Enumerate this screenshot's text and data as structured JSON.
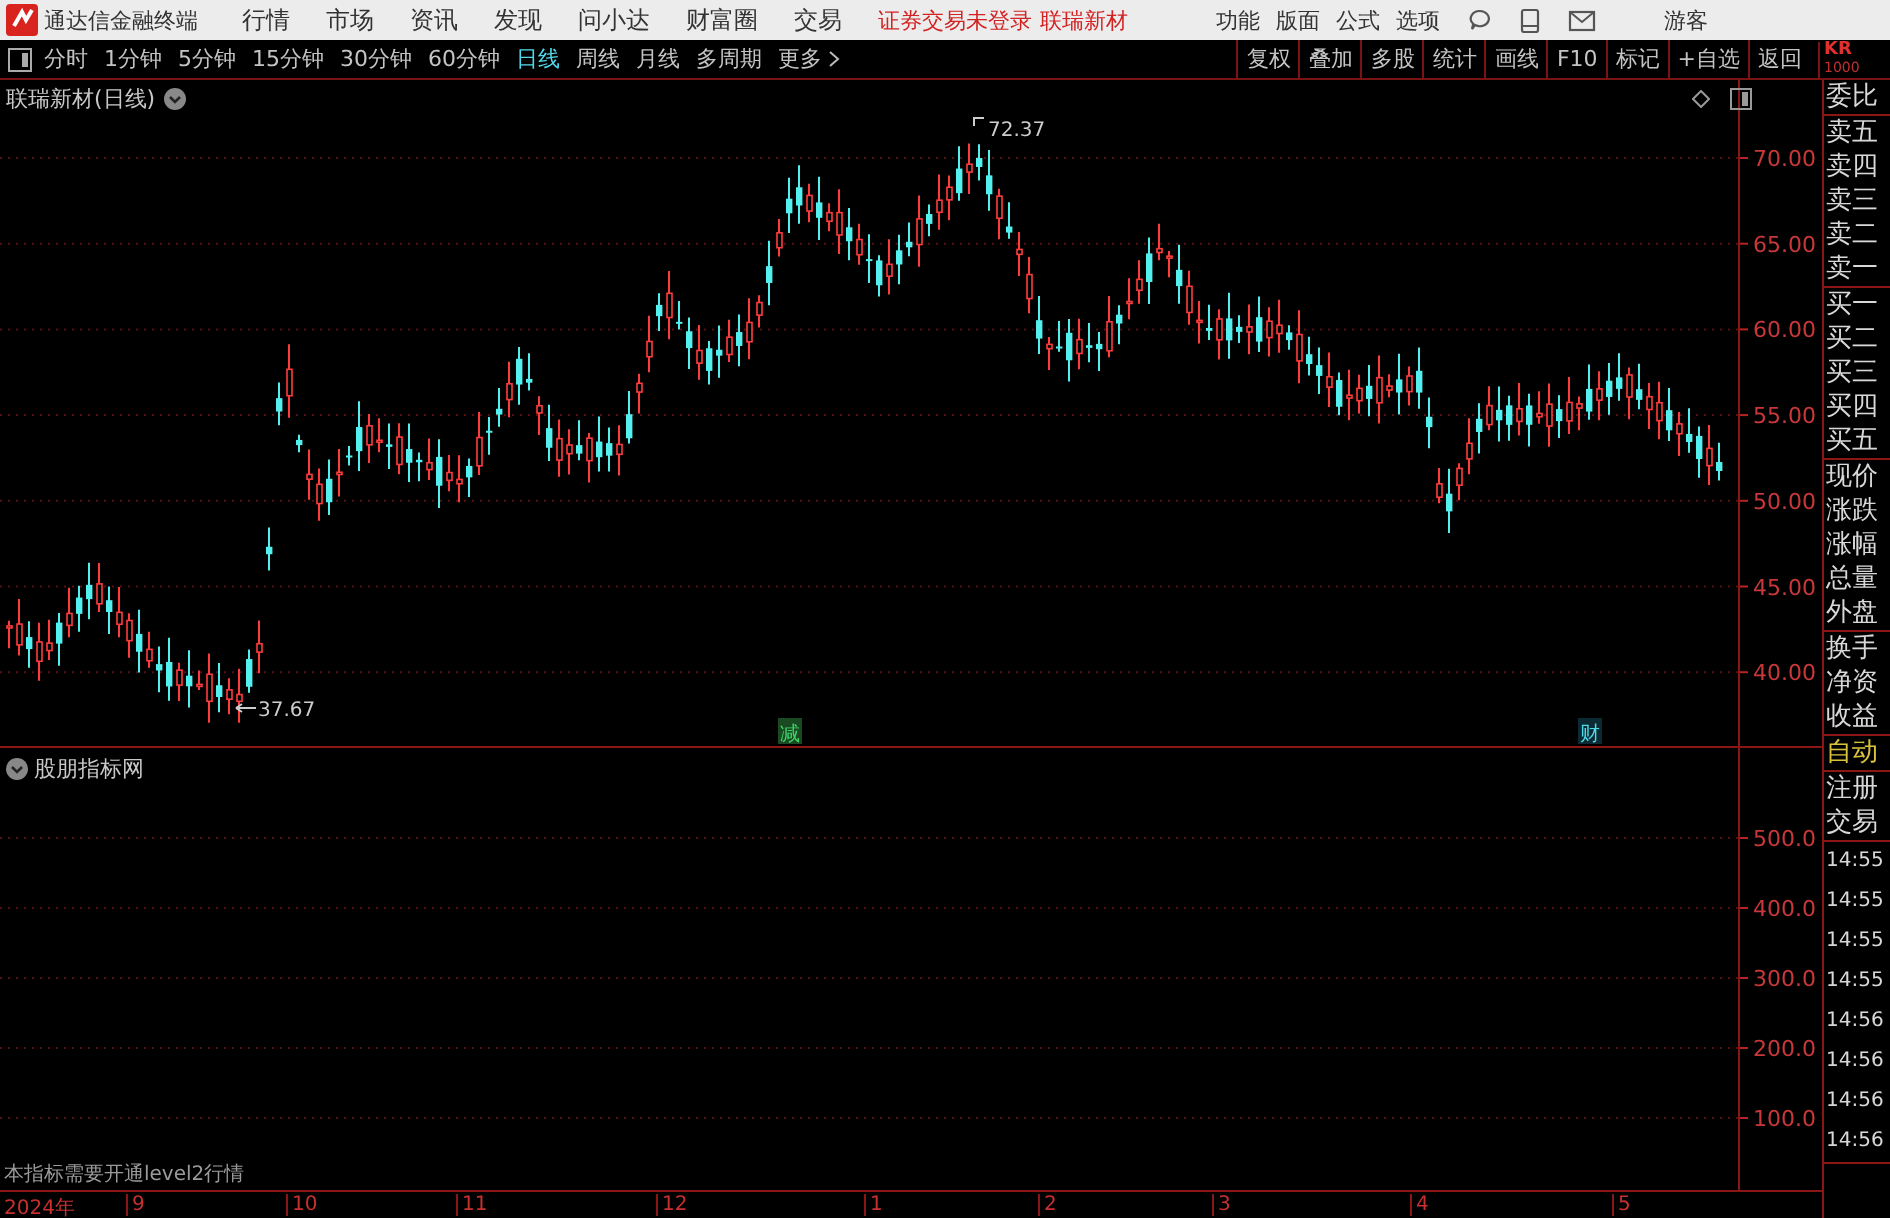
{
  "menu_bar": {
    "app_title": "通达信金融终端",
    "menus": [
      "行情",
      "市场",
      "资讯",
      "发现",
      "问小达",
      "财富圈",
      "交易"
    ],
    "status_notice": "证券交易未登录",
    "stock_link": "联瑞新材",
    "tools": [
      "功能",
      "版面",
      "公式",
      "选项"
    ],
    "user": "游客"
  },
  "period_tabs": [
    {
      "label": "分时",
      "selected": false
    },
    {
      "label": "1分钟",
      "selected": false
    },
    {
      "label": "5分钟",
      "selected": false
    },
    {
      "label": "15分钟",
      "selected": false
    },
    {
      "label": "30分钟",
      "selected": false
    },
    {
      "label": "60分钟",
      "selected": false
    },
    {
      "label": "日线",
      "selected": true
    },
    {
      "label": "周线",
      "selected": false
    },
    {
      "label": "月线",
      "selected": false
    },
    {
      "label": "多周期",
      "selected": false
    },
    {
      "label": "更多",
      "selected": false
    }
  ],
  "toolbar_buttons": [
    "复权",
    "叠加",
    "多股",
    "统计",
    "画线",
    "F10",
    "标记",
    "+自选",
    "返回"
  ],
  "quote_header": {
    "code": "KR",
    "sub": "1000"
  },
  "main_chart": {
    "title": "联瑞新材(日线)",
    "high_label": "72.37",
    "low_label": "37.67",
    "y_ticks": [
      "70.00",
      "65.00",
      "60.00",
      "55.00",
      "50.00",
      "45.00",
      "40.00"
    ],
    "markers": [
      {
        "text": "减",
        "kind": "reduce"
      },
      {
        "text": "财",
        "kind": "finance"
      }
    ]
  },
  "indicator": {
    "title": "股朋指标网",
    "note": "本指标需要开通level2行情",
    "y_ticks": [
      "500.0",
      "400.0",
      "300.0",
      "200.0",
      "100.0"
    ]
  },
  "date_axis": {
    "year": "2024年",
    "months": [
      "9",
      "10",
      "11",
      "12",
      "1",
      "2",
      "3",
      "4",
      "5"
    ]
  },
  "quote_groups": [
    [
      {
        "text": "委比",
        "kind": "label"
      }
    ],
    [
      {
        "text": "卖五",
        "kind": "label"
      },
      {
        "text": "卖四",
        "kind": "label"
      },
      {
        "text": "卖三",
        "kind": "label"
      },
      {
        "text": "卖二",
        "kind": "label"
      },
      {
        "text": "卖一",
        "kind": "label"
      }
    ],
    [
      {
        "text": "买一",
        "kind": "label"
      },
      {
        "text": "买二",
        "kind": "label"
      },
      {
        "text": "买三",
        "kind": "label"
      },
      {
        "text": "买四",
        "kind": "label"
      },
      {
        "text": "买五",
        "kind": "label"
      }
    ],
    [
      {
        "text": "现价",
        "kind": "label"
      },
      {
        "text": "涨跌",
        "kind": "label"
      },
      {
        "text": "涨幅",
        "kind": "label"
      },
      {
        "text": "总量",
        "kind": "label"
      },
      {
        "text": "外盘",
        "kind": "label"
      }
    ],
    [
      {
        "text": "换手",
        "kind": "label"
      },
      {
        "text": "净资",
        "kind": "label"
      },
      {
        "text": "收益",
        "kind": "label"
      }
    ],
    [
      {
        "text": "自动",
        "kind": "status"
      }
    ],
    [
      {
        "text": "注册",
        "kind": "label"
      },
      {
        "text": "交易",
        "kind": "label"
      }
    ],
    [
      {
        "text": "14:55",
        "kind": "time"
      },
      {
        "text": "14:55",
        "kind": "time"
      },
      {
        "text": "14:55",
        "kind": "time"
      },
      {
        "text": "14:55",
        "kind": "time"
      },
      {
        "text": "14:56",
        "kind": "time"
      },
      {
        "text": "14:56",
        "kind": "time"
      },
      {
        "text": "14:56",
        "kind": "time"
      },
      {
        "text": "14:56",
        "kind": "time"
      }
    ]
  ]
}
